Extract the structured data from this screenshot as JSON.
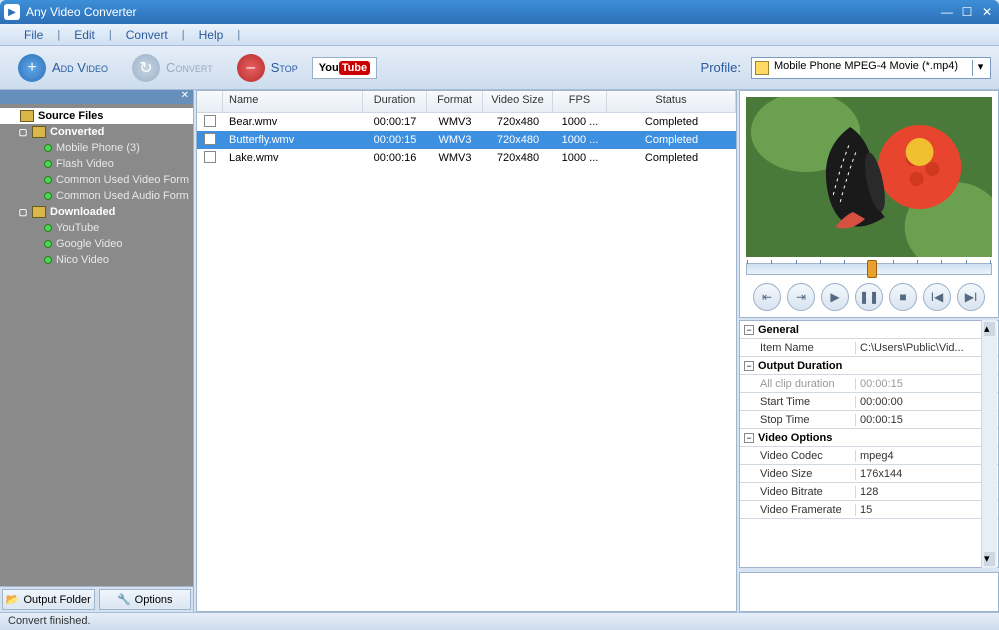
{
  "title": "Any Video Converter",
  "menu": [
    "File",
    "Edit",
    "Convert",
    "Help"
  ],
  "toolbar": {
    "addVideo": "Add Video",
    "convert": "Convert",
    "stop": "Stop",
    "youtube": "YouTube",
    "profileLabel": "Profile:",
    "profileValue": "Mobile Phone MPEG-4 Movie (*.mp4)"
  },
  "tree": {
    "root": "Source Files",
    "converted": "Converted",
    "convertedChildren": [
      "Mobile Phone (3)",
      "Flash Video",
      "Common Used Video Form",
      "Common Used Audio Form"
    ],
    "downloaded": "Downloaded",
    "downloadedChildren": [
      "YouTube",
      "Google Video",
      "Nico Video"
    ]
  },
  "sidebarButtons": {
    "outputFolder": "Output Folder",
    "options": "Options"
  },
  "columns": [
    "",
    "Name",
    "Duration",
    "Format",
    "Video Size",
    "FPS",
    "Status"
  ],
  "rows": [
    {
      "name": "Bear.wmv",
      "duration": "00:00:17",
      "format": "WMV3",
      "size": "720x480",
      "fps": "1000 ...",
      "status": "Completed",
      "sel": false
    },
    {
      "name": "Butterfly.wmv",
      "duration": "00:00:15",
      "format": "WMV3",
      "size": "720x480",
      "fps": "1000 ...",
      "status": "Completed",
      "sel": true
    },
    {
      "name": "Lake.wmv",
      "duration": "00:00:16",
      "format": "WMV3",
      "size": "720x480",
      "fps": "1000 ...",
      "status": "Completed",
      "sel": false
    }
  ],
  "props": {
    "sections": [
      {
        "title": "General",
        "rows": [
          {
            "k": "Item Name",
            "v": "C:\\Users\\Public\\Vid..."
          }
        ]
      },
      {
        "title": "Output Duration",
        "rows": [
          {
            "k": "All clip duration",
            "v": "00:00:15",
            "ro": true
          },
          {
            "k": "Start Time",
            "v": "00:00:00"
          },
          {
            "k": "Stop Time",
            "v": "00:00:15"
          }
        ]
      },
      {
        "title": "Video Options",
        "rows": [
          {
            "k": "Video Codec",
            "v": "mpeg4"
          },
          {
            "k": "Video Size",
            "v": "176x144"
          },
          {
            "k": "Video Bitrate",
            "v": "128"
          },
          {
            "k": "Video Framerate",
            "v": "15"
          }
        ]
      }
    ]
  },
  "status": "Convert finished."
}
